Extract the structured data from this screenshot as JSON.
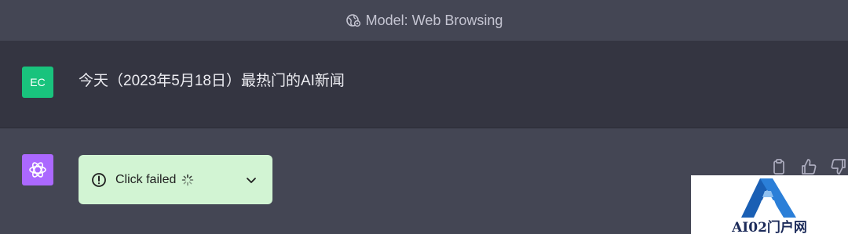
{
  "header": {
    "model_label": "Model: Web Browsing",
    "icon": "globe-gear-icon"
  },
  "user_message": {
    "avatar_initials": "EC",
    "avatar_color": "#19c37d",
    "text": "今天（2023年5月18日）最热门的AI新闻"
  },
  "assistant_message": {
    "avatar_icon": "openai-logo-icon",
    "avatar_color": "#ab68ff",
    "status": {
      "text": "Click failed",
      "icon": "alert-circle-icon",
      "loading_icon": "spinner-icon",
      "expand_icon": "chevron-down-icon",
      "background": "#d2f4d3"
    },
    "actions": [
      "copy-icon",
      "thumbs-up-icon",
      "thumbs-down-icon"
    ]
  },
  "watermark": {
    "text": "AI02门户网"
  }
}
